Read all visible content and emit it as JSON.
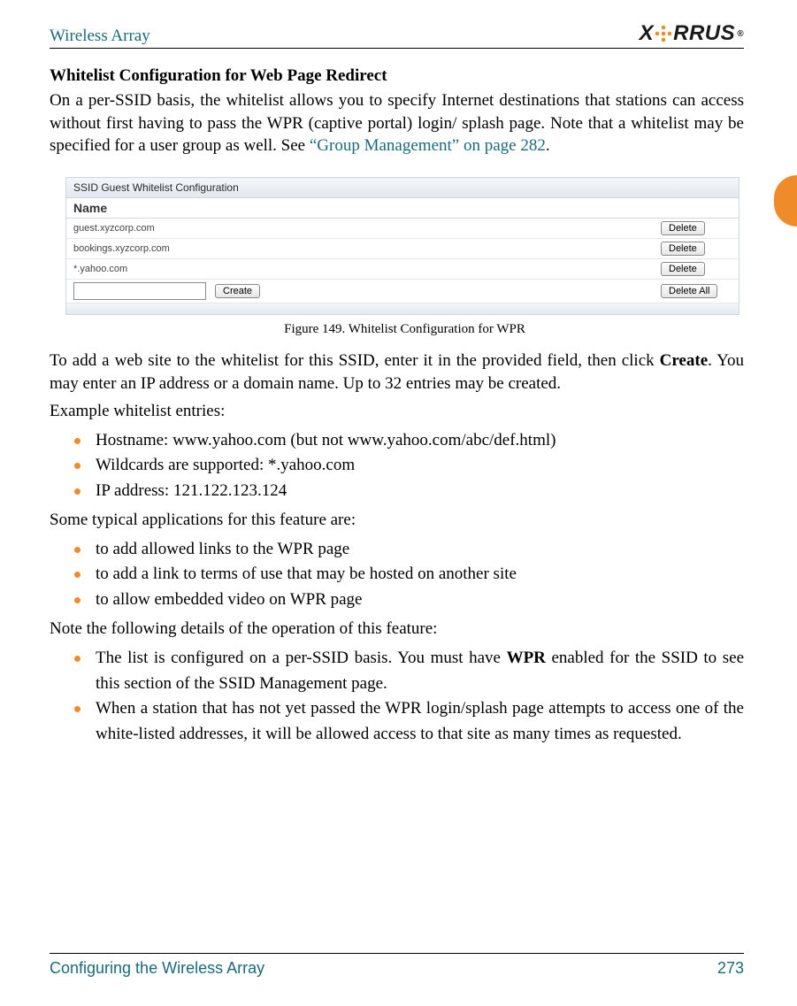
{
  "header": {
    "doc_title": "Wireless Array",
    "logo_text_left": "X",
    "logo_text_right": "RRUS",
    "logo_reg": "®"
  },
  "section": {
    "heading": "Whitelist Configuration for Web Page Redirect",
    "intro_a": "On a per-SSID basis, the whitelist allows you to specify Internet destinations that stations can access without first having to pass the WPR (captive portal) login/ splash page. Note that a whitelist may be specified for a user group as well. See ",
    "intro_link": "“Group Management” on page 282",
    "intro_b": "."
  },
  "figure": {
    "panel_title": "SSID Guest   Whitelist Configuration",
    "col_name": "Name",
    "rows": [
      "guest.xyzcorp.com",
      "bookings.xyzcorp.com",
      "*.yahoo.com"
    ],
    "btn_delete": "Delete",
    "btn_create": "Create",
    "btn_delete_all": "Delete All",
    "caption": "Figure 149. Whitelist Configuration for WPR"
  },
  "body": {
    "p1a": "To add a web site to the whitelist for this SSID, enter it in the provided field, then click ",
    "p1b": "Create",
    "p1c": ". You may enter an IP address or a domain name. Up to 32 entries may be created.",
    "p2": "Example whitelist entries:",
    "examples": [
      "Hostname: www.yahoo.com (but not www.yahoo.com/abc/def.html)",
      "Wildcards are supported: *.yahoo.com",
      "IP address: 121.122.123.124"
    ],
    "p3": "Some typical applications for this feature are:",
    "apps": [
      "to add allowed links to the WPR page",
      "to add a link to terms of use that may be hosted on another site",
      "to allow embedded video on WPR page"
    ],
    "p4": "Note the following details of the operation of this feature:",
    "details_0a": "The list is configured on a per-SSID basis. You must have ",
    "details_0b": "WPR",
    "details_0c": " enabled for the SSID to see this section of the SSID Management page.",
    "details_1": "When a station that has not yet passed the WPR login/splash page attempts to access one of the white-listed addresses, it will be allowed access to that site as many times as requested."
  },
  "footer": {
    "left": "Configuring the Wireless Array",
    "right": "273"
  }
}
